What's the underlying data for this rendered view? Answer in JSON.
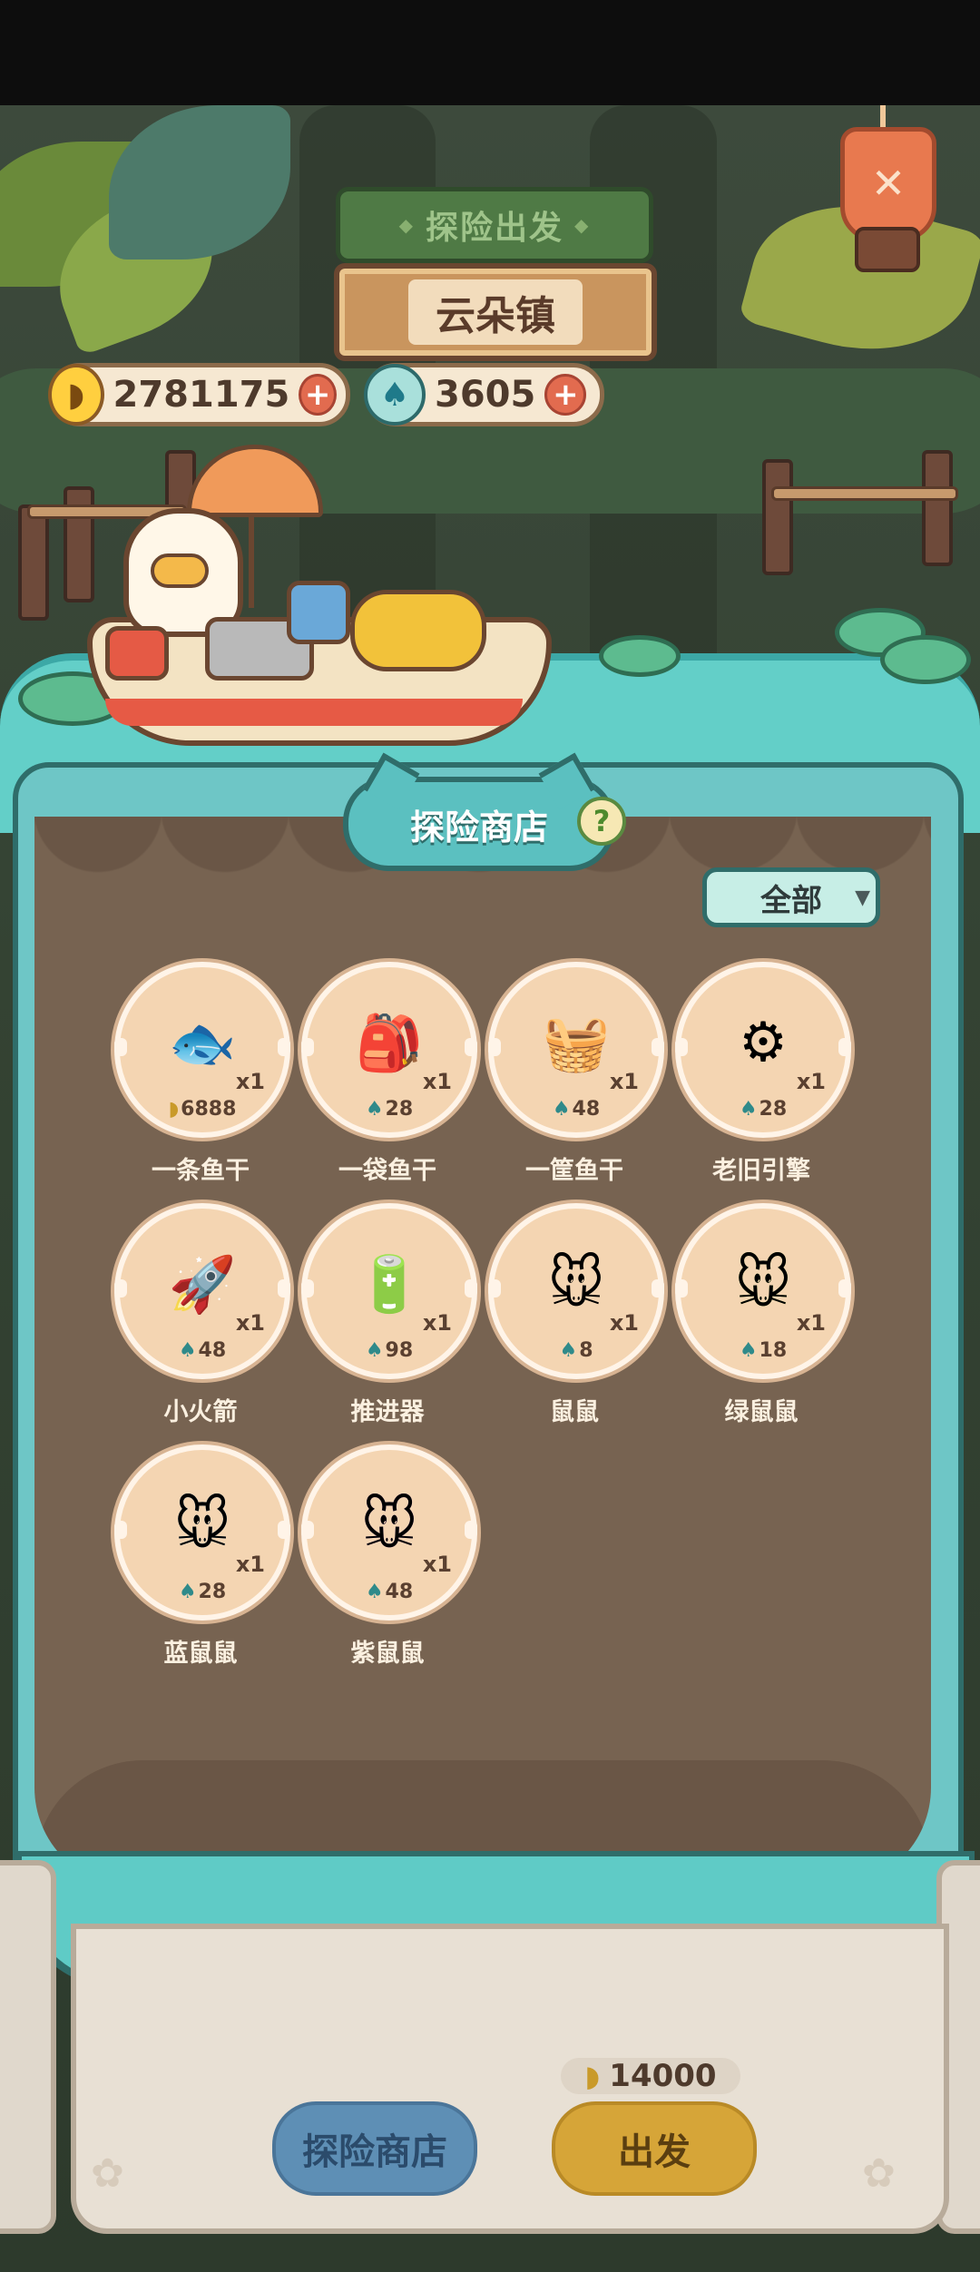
{
  "header": {
    "ribbon_label": "探险出发",
    "town_name": "云朵镇",
    "close_icon": "close-icon"
  },
  "currency": {
    "banana": {
      "icon": "banana-icon",
      "value": "2781175"
    },
    "flame": {
      "icon": "blue-flame-icon",
      "value": "3605"
    }
  },
  "shop": {
    "title": "探险商店",
    "help_label": "?",
    "filter_label": "全部",
    "items": [
      {
        "name": "一条鱼干",
        "icon": "fish-icon",
        "qty": "x1",
        "currency": "banana",
        "price": "6888"
      },
      {
        "name": "一袋鱼干",
        "icon": "fish-bag-icon",
        "qty": "x1",
        "currency": "flame",
        "price": "28"
      },
      {
        "name": "一筐鱼干",
        "icon": "fish-basket-icon",
        "qty": "x1",
        "currency": "flame",
        "price": "48"
      },
      {
        "name": "老旧引擎",
        "icon": "old-engine-icon",
        "qty": "x1",
        "currency": "flame",
        "price": "28"
      },
      {
        "name": "小火箭",
        "icon": "rocket-icon",
        "qty": "x1",
        "currency": "flame",
        "price": "48"
      },
      {
        "name": "推进器",
        "icon": "thruster-icon",
        "qty": "x1",
        "currency": "flame",
        "price": "98"
      },
      {
        "name": "鼠鼠",
        "icon": "mouse-icon",
        "qty": "x1",
        "currency": "flame",
        "price": "8"
      },
      {
        "name": "绿鼠鼠",
        "icon": "green-mouse-icon",
        "qty": "x1",
        "currency": "flame",
        "price": "18"
      },
      {
        "name": "蓝鼠鼠",
        "icon": "blue-mouse-icon",
        "qty": "x1",
        "currency": "flame",
        "price": "28"
      },
      {
        "name": "紫鼠鼠",
        "icon": "purple-mouse-icon",
        "qty": "x1",
        "currency": "flame",
        "price": "48"
      }
    ]
  },
  "footer": {
    "cost_value": "14000",
    "shop_button": "探险商店",
    "go_button": "出发"
  },
  "colors": {
    "panel_teal": "#6ec6c6",
    "panel_brown": "#776351",
    "go_yellow": "#d6a538",
    "shop_blue": "#5e8fb5"
  }
}
